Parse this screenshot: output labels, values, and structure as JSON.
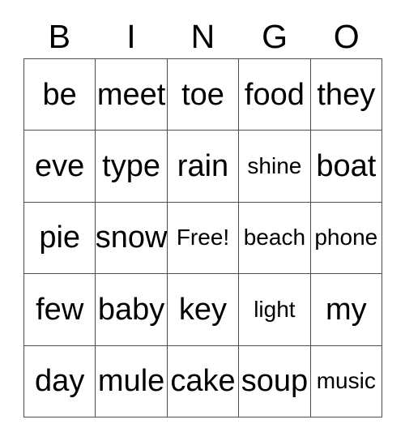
{
  "card": {
    "type": "bingo-card",
    "columns": 5,
    "rows": 5,
    "background_color": "#ffffff",
    "text_color": "#000000",
    "border_color": "#4d4d4d"
  },
  "header": {
    "letters": [
      "B",
      "I",
      "N",
      "G",
      "O"
    ]
  },
  "grid": {
    "free_space_label": "Free!",
    "free_space_position": {
      "row": 3,
      "column": 3
    },
    "rows": [
      [
        "be",
        "meet",
        "toe",
        "food",
        "they"
      ],
      [
        "eve",
        "type",
        "rain",
        "shine",
        "boat"
      ],
      [
        "pie",
        "snow",
        "Free!",
        "beach",
        "phone"
      ],
      [
        "few",
        "baby",
        "key",
        "light",
        "my"
      ],
      [
        "day",
        "mule",
        "cake",
        "soup",
        "music"
      ]
    ]
  }
}
